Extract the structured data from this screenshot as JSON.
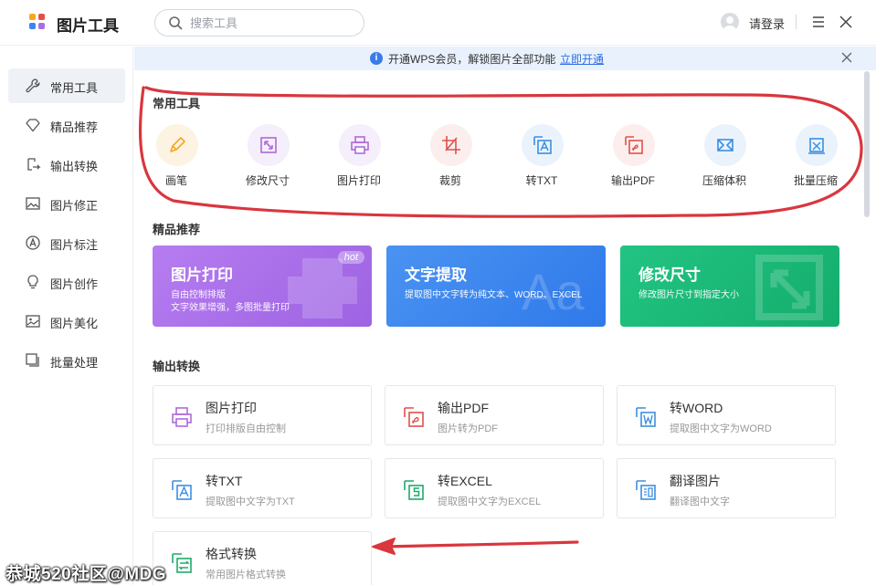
{
  "app": {
    "title": "图片工具"
  },
  "search": {
    "placeholder": "搜索工具",
    "value": ""
  },
  "header": {
    "login_label": "请登录"
  },
  "banner": {
    "text": "开通WPS会员，解锁图片全部功能",
    "link": "立即开通"
  },
  "sidebar": {
    "items": [
      {
        "label": "常用工具",
        "icon": "wrench-icon",
        "active": true
      },
      {
        "label": "精品推荐",
        "icon": "diamond-icon"
      },
      {
        "label": "输出转换",
        "icon": "convert-icon"
      },
      {
        "label": "图片修正",
        "icon": "image-edit-icon"
      },
      {
        "label": "图片标注",
        "icon": "annotate-icon"
      },
      {
        "label": "图片创作",
        "icon": "bulb-icon"
      },
      {
        "label": "图片美化",
        "icon": "image-icon"
      },
      {
        "label": "批量处理",
        "icon": "batch-icon"
      }
    ]
  },
  "common": {
    "title": "常用工具",
    "tools": [
      {
        "label": "画笔",
        "icon": "pen-icon",
        "color": "#f5a623"
      },
      {
        "label": "修改尺寸",
        "icon": "resize-icon",
        "color": "#b06ad8"
      },
      {
        "label": "图片打印",
        "icon": "printer-icon",
        "color": "#b06ad8"
      },
      {
        "label": "裁剪",
        "icon": "crop-icon",
        "color": "#e0504a"
      },
      {
        "label": "转TXT",
        "icon": "to-txt-icon",
        "color": "#3b8fe0"
      },
      {
        "label": "输出PDF",
        "icon": "pdf-icon",
        "color": "#e0504a"
      },
      {
        "label": "压缩体积",
        "icon": "compress-icon",
        "color": "#3b8fe0"
      },
      {
        "label": "批量压缩",
        "icon": "batch-compress-icon",
        "color": "#3b8fe0"
      }
    ]
  },
  "recommend": {
    "title": "精品推荐",
    "cards": [
      {
        "title": "图片打印",
        "desc1": "自由控制排版",
        "desc2": "文字效果增强，多图批量打印",
        "badge": "hot",
        "color": "#a86ee6"
      },
      {
        "title": "文字提取",
        "desc1": "提取图中文字转为纯文本、WORD、EXCEL",
        "desc2": "",
        "color": "#3b86ef"
      },
      {
        "title": "修改尺寸",
        "desc1": "修改图片尺寸到指定大小",
        "desc2": "",
        "color": "#1dba78"
      }
    ]
  },
  "output": {
    "title": "输出转换",
    "cards": [
      {
        "title": "图片打印",
        "desc": "打印排版自由控制",
        "icon": "printer-icon"
      },
      {
        "title": "输出PDF",
        "desc": "图片转为PDF",
        "icon": "pdf-icon"
      },
      {
        "title": "转WORD",
        "desc": "提取图中文字为WORD",
        "icon": "word-icon"
      },
      {
        "title": "转TXT",
        "desc": "提取图中文字为TXT",
        "icon": "to-txt-icon"
      },
      {
        "title": "转EXCEL",
        "desc": "提取图中文字为EXCEL",
        "icon": "excel-icon"
      },
      {
        "title": "翻译图片",
        "desc": "翻译图中文字",
        "icon": "translate-icon"
      },
      {
        "title": "格式转换",
        "desc": "常用图片格式转换",
        "icon": "format-convert-icon"
      }
    ]
  },
  "watermark": "恭城520社区@MDG",
  "colors": {
    "accent": "#3b7be8",
    "annotation_red": "#d9363e"
  }
}
